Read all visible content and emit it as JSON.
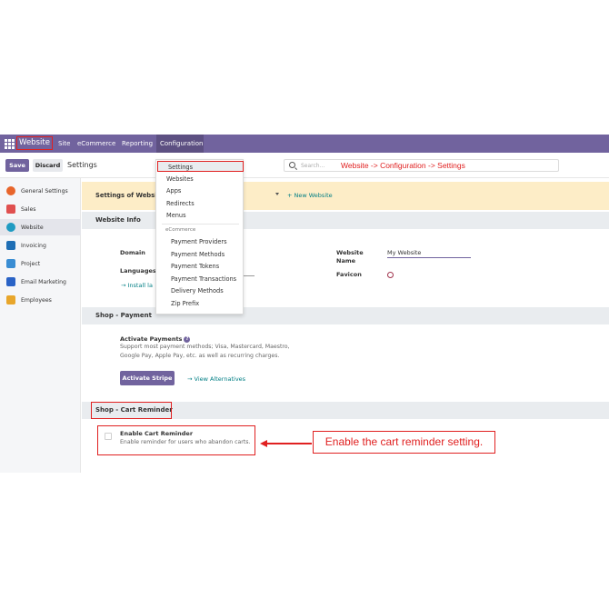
{
  "navbar": {
    "apps_icon": "grid-apps-icon",
    "brand": "Website",
    "menu": [
      "Site",
      "eCommerce",
      "Reporting",
      "Configuration"
    ],
    "bg_color": "#71639e"
  },
  "control": {
    "save": "Save",
    "discard": "Discard",
    "breadcrumb": "Settings",
    "search_placeholder": "Search...",
    "annotation": "Website -> Configuration -> Settings"
  },
  "sidebar": {
    "items": [
      {
        "label": "General Settings",
        "icon": "settings-gear-icon",
        "color": "#e8652b"
      },
      {
        "label": "Sales",
        "icon": "sales-chart-icon",
        "color": "#e0504f"
      },
      {
        "label": "Website",
        "icon": "globe-icon",
        "color": "#1f9bc2"
      },
      {
        "label": "Invoicing",
        "icon": "invoice-icon",
        "color": "#1f6fb5"
      },
      {
        "label": "Project",
        "icon": "check-icon",
        "color": "#3a8dd3"
      },
      {
        "label": "Email Marketing",
        "icon": "paper-plane-icon",
        "color": "#2a63c6"
      },
      {
        "label": "Employees",
        "icon": "people-icon",
        "color": "#e8a62b"
      }
    ],
    "active": "Website"
  },
  "dropdown": {
    "items": [
      "Settings",
      "Websites",
      "Apps",
      "Redirects",
      "Menus"
    ],
    "group_label": "eCommerce",
    "group_items": [
      "Payment Providers",
      "Payment Methods",
      "Payment Tokens",
      "Payment Transactions",
      "Delivery Methods",
      "Zip Prefix"
    ]
  },
  "main": {
    "settings_of_website": "Settings of Website",
    "new_website": "+ New Website",
    "website_info": {
      "title": "Website Info",
      "domain_label": "Domain",
      "languages_label": "Languages",
      "install_link": "→ Install la",
      "website_name_label": "Website Name",
      "website_name_value": "My Website",
      "favicon_label": "Favicon"
    },
    "shop_payment": {
      "title": "Shop - Payment",
      "activate_payments": "Activate Payments",
      "help": "?",
      "desc_line1": "Support most payment methods; Visa, Mastercard, Maestro,",
      "desc_line2": "Google Pay, Apple Pay, etc. as well as recurring charges.",
      "activate_stripe": "Activate Stripe",
      "view_alternatives": "→ View Alternatives"
    },
    "cart_reminder": {
      "title": "Shop - Cart Reminder",
      "setting_label": "Enable Cart Reminder",
      "setting_desc": "Enable reminder for users who abandon carts.",
      "checked": false
    }
  },
  "annotation": "Enable the cart reminder setting.",
  "colors": {
    "annotation_red": "#e02020",
    "link_teal": "#017e84",
    "primary": "#71639e"
  }
}
